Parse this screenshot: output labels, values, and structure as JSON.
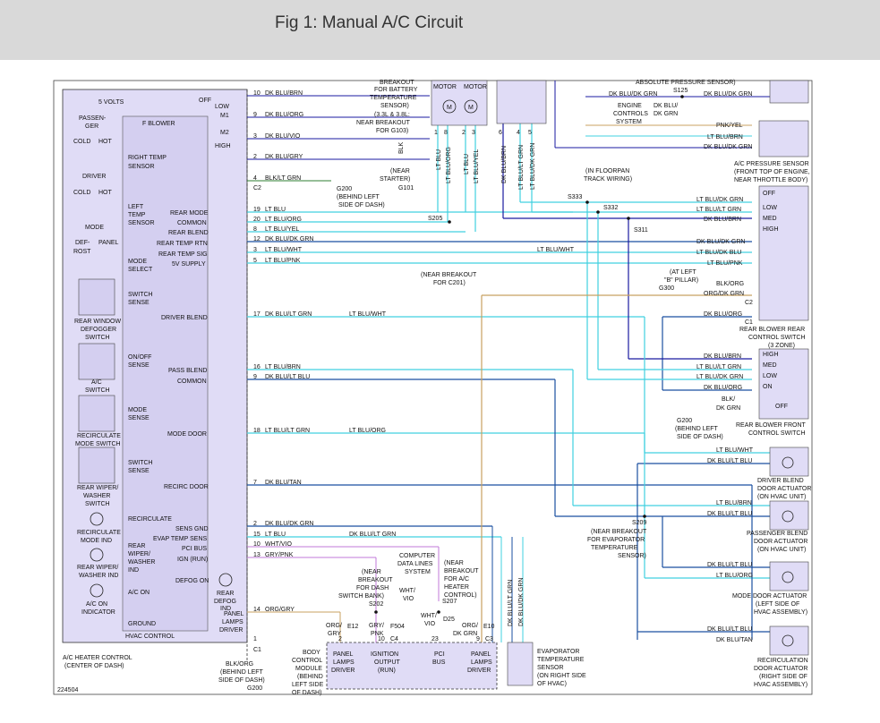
{
  "header": {
    "title": "Fig 1: Manual A/C Circuit"
  },
  "hvac": {
    "title": "HVAC CONTROL",
    "caption1": "A/C HEATER CONTROL",
    "caption2": "(CENTER OF DASH)",
    "five_volts": "5 VOLTS",
    "fig_number": "224504",
    "passenger": "PASSEN-",
    "passenger2": "GER",
    "driver": "DRIVER",
    "mode": "MODE",
    "cold": "COLD",
    "hot": "HOT",
    "cold2": "COLD",
    "hot2": "HOT",
    "defrost1": "DEF-",
    "defrost2": "ROST",
    "panel": "PANEL",
    "f_blower": "F BLOWER",
    "off": "OFF",
    "low": "LOW",
    "m1": "M1",
    "m2": "M2",
    "high": "HIGH",
    "right_temp1": "RIGHT TEMP",
    "right_temp2": "SENSOR",
    "left_temp1": "LEFT",
    "left_temp2": "TEMP",
    "left_temp3": "SENSOR",
    "mode_select1": "MODE",
    "mode_select2": "SELECT",
    "rear_mode": "REAR MODE",
    "common": "COMMON",
    "rear_blend": "REAR BLEND",
    "rear_temp_rtn": "REAR TEMP RTN",
    "rear_temp_sig": "REAR TEMP SIG",
    "supply_5v": "5V SUPPLY",
    "switch_sense1": "SWITCH",
    "switch_sense2": "SENSE",
    "rear_window1": "REAR WINDOW",
    "rear_window2": "DEFOGGER",
    "rear_window3": "SWITCH",
    "driver_blend": "DRIVER BLEND",
    "onoff_sense1": "ON/OFF",
    "onoff_sense2": "SENSE",
    "ac_switch1": "A/C",
    "ac_switch2": "SWITCH",
    "pass_blend": "PASS BLEND",
    "common2": "COMMON",
    "mode_sense1": "MODE",
    "mode_sense2": "SENSE",
    "recirc_mode1": "RECIRCULATE",
    "recirc_mode2": "MODE SWITCH",
    "mode_door": "MODE DOOR",
    "switch_sense3": "SWITCH",
    "switch_sense4": "SENSE",
    "rear_wiper1": "REAR WIPER/",
    "rear_wiper2": "WASHER",
    "rear_wiper3": "SWITCH",
    "recirc_door": "RECIRC DOOR",
    "recirculate": "RECIRCULATE",
    "recirc_ind1": "RECIRCULATE",
    "recirc_ind2": "MODE IND",
    "rear_wiper_ind1": "REAR",
    "rear_wiper_ind2": "WIPER/",
    "rear_wiper_ind3": "WASHER",
    "rear_wiper_ind4": "IND",
    "rw_ind1": "REAR WIPER/",
    "rw_ind2": "WASHER IND",
    "ac_on": "A/C ON",
    "ac_on_ind1": "A/C ON",
    "ac_on_ind2": "INDICATOR",
    "sens_gnd": "SENS GND",
    "evap_temp_sens": "EVAP TEMP SENS",
    "pci_bus": "PCI BUS",
    "ign_run": "IGN (RUN)",
    "defog_on": "DEFOG ON",
    "rear_defog1": "REAR",
    "rear_defog2": "DEFOG",
    "rear_defog3": "IND",
    "panel_lamps1": "PANEL",
    "panel_lamps2": "LAMPS",
    "panel_lamps3": "DRIVER",
    "ground": "GROUND"
  },
  "wires": [
    {
      "pin": "10",
      "color": "DK BLU/BRN"
    },
    {
      "pin": "9",
      "color": "DK BLU/ORG"
    },
    {
      "pin": "3",
      "color": "DK BLU/VIO"
    },
    {
      "pin": "2",
      "color": "DK BLU/GRY"
    },
    {
      "pin": "4",
      "color": "BLK/LT GRN"
    },
    {
      "pin": "19",
      "color": "LT BLU"
    },
    {
      "pin": "20",
      "color": "LT BLU/ORG"
    },
    {
      "pin": "8",
      "color": "LT BLU/YEL"
    },
    {
      "pin": "12",
      "color": "DK BLU/DK GRN"
    },
    {
      "pin": "3",
      "color": "LT BLU/WHT"
    },
    {
      "pin": "5",
      "color": "LT BLU/PNK"
    },
    {
      "pin": "17",
      "color": "DK BLU/LT GRN"
    },
    {
      "pin": "16",
      "color": "LT BLU/BRN"
    },
    {
      "pin": "9",
      "color": "DK BLU/LT BLU"
    },
    {
      "pin": "18",
      "color": "LT BLU/LT GRN"
    },
    {
      "pin": "7",
      "color": "DK BLU/TAN"
    },
    {
      "pin": "2",
      "color": "DK BLU/DK GRN"
    },
    {
      "pin": "15",
      "color": "LT BLU"
    },
    {
      "pin": "10",
      "color": "WHT/VIO"
    },
    {
      "pin": "13",
      "color": "GRY/PNK"
    },
    {
      "pin": "14",
      "color": "ORG/GRY"
    },
    {
      "pin": "1",
      "color": ""
    }
  ],
  "labels": {
    "c2": "C2",
    "c1": "C1",
    "g200_1": "G200",
    "g200_2": "(BEHIND LEFT",
    "g200_3": "SIDE OF DASH)",
    "lt_blu_wht_mid": "LT BLU/WHT",
    "lt_blu_wht_mid2": "LT BLU/WHT",
    "lt_blu_org_mid": "LT BLU/ORG",
    "dk_blu_lt_grn_mid": "DK BLU/LT GRN",
    "s205": "S205",
    "near_breakout1": "(NEAR BREAKOUT",
    "near_breakout2": "FOR C201)",
    "breakout_top1": "BREAKOUT",
    "breakout_top2": "FOR BATTERY",
    "breakout_top3": "TEMPERATURE",
    "breakout_top4": "SENSOR)",
    "breakout_top5": "(3.3L & 3.8L:",
    "breakout_top6": "NEAR BREAKOUT",
    "breakout_top7": "FOR G103)",
    "blk": "BLK",
    "near_starter1": "(NEAR",
    "near_starter2": "STARTER)",
    "g101": "G101",
    "motor1": "MOTOR",
    "motor2": "MOTOR",
    "top_wires": [
      "LT BLU",
      "LT BLU/ORG",
      "LT BLU",
      "LT BLU/YEL",
      "DK BLU/BRN",
      "LT BLU/LT GRN",
      "LT BLU/DK GRN"
    ],
    "top_pins": [
      "1",
      "8",
      "2",
      "3",
      "6",
      "4",
      "5"
    ],
    "abs_pressure": "ABSOLUTE PRESSURE SENSOR)",
    "s125": "S125",
    "dk_blu_dk_grn_top": "DK BLU/DK GRN",
    "dk_blu_dk_grn_top2": "DK BLU/DK GRN",
    "ecs1": "ENGINE",
    "ecs2": "CONTROLS",
    "ecs3": "SYSTEM",
    "dk_blu_dk_grn_v1": "DK BLU/",
    "dk_blu_dk_grn_v2": "DK GRN",
    "pnk_yel": "PNK/YEL",
    "lt_blu_brn_r": "LT BLU/BRN",
    "dk_blu_dk_grn_r": "DK BLU/DK GRN",
    "ac_pressure1": "A/C PRESSURE SENSOR",
    "ac_pressure2": "(FRONT TOP OF ENGINE,",
    "ac_pressure3": "NEAR THROTTLE BODY)",
    "floorpan1": "(IN FLOORPAN",
    "floorpan2": "TRACK WIRING)",
    "s333": "S333",
    "s332": "S332",
    "s311": "S311",
    "rb_wire1": "LT BLU/DK GRN",
    "rb_wire2": "LT BLU/LT GRN",
    "rb_wire3": "DK BLU/BRN",
    "rb_wire4": "DK BLU/DK GRN",
    "rb_wire5": "LT BLU/DK BLU",
    "rb_wire6": "LT BLU/PNK",
    "rb_off": "OFF",
    "rb_low": "LOW",
    "rb_med": "MED",
    "rb_high": "HIGH",
    "at_left1": "(AT LEFT",
    "at_left2": "\"B\" PILLAR)",
    "g300": "G300",
    "blk_org": "BLK/ORG",
    "org_dk_grn": "ORG/DK GRN",
    "c2r": "C2",
    "dk_blu_org_r": "DK BLU/ORG",
    "c1r": "C1",
    "rear_ctrl1": "REAR BLOWER REAR",
    "rear_ctrl2": "CONTROL SWITCH",
    "rear_ctrl3": "(3 ZONE)",
    "fb_wire1": "DK BLU/BRN",
    "fb_wire2": "LT BLU/LT GRN",
    "fb_wire3": "LT BLU/DK GRN",
    "fb_wire4": "DK BLU/ORG",
    "fb_high": "HIGH",
    "fb_med": "MED",
    "fb_low": "LOW",
    "fb_on": "ON",
    "fb_off": "OFF",
    "blk_dkgrn1": "BLK/",
    "blk_dkgrn2": "DK GRN",
    "g200r1": "G200",
    "g200r2": "(BEHIND LEFT",
    "g200r3": "SIDE OF DASH)",
    "front_ctrl1": "REAR BLOWER FRONT",
    "front_ctrl2": "CONTROL SWITCH",
    "lt_blu_org_mid2": "LT BLU/ORG",
    "lt_blu_wht_r": "LT BLU/WHT",
    "dk_blu_lt_blu_r": "DK BLU/LT BLU",
    "driver_blend1": "DRIVER BLEND",
    "driver_blend2": "DOOR ACTUATOR",
    "driver_blend3": "(ON HVAC UNIT)",
    "lt_blu_brn_p": "LT BLU/BRN",
    "dk_blu_lt_blu_p": "DK BLU/LT BLU",
    "s209": "S209",
    "near_evap1": "(NEAR BREAKOUT",
    "near_evap2": "FOR EVAPORATOR",
    "near_evap3": "TEMPERATURE",
    "near_evap4": "SENSOR)",
    "pass_blend1": "PASSENGER BLEND",
    "pass_blend2": "DOOR ACTUATOR",
    "pass_blend3": "(ON HVAC UNIT)",
    "dk_blu_lt_blu_m": "DK BLU/LT BLU",
    "lt_blu_org_m": "LT BLU/ORG",
    "mode_door1": "MODE DOOR ACTUATOR",
    "mode_door2": "(LEFT SIDE OF",
    "mode_door3": "HVAC ASSEMBLY)",
    "dk_blu_lt_blu_rc": "DK BLU/LT BLU",
    "dk_blu_tan_rc": "DK BLU/TAN",
    "recirc_act1": "RECIRCULATION",
    "recirc_act2": "DOOR ACTUATOR",
    "recirc_act3": "(RIGHT SIDE OF",
    "recirc_act4": "HVAC ASSEMBLY)",
    "evap1": "EVAPORATOR",
    "evap2": "TEMPERATURE",
    "evap3": "SENSOR",
    "evap4": "(ON RIGHT SIDE",
    "evap5": "OF HVAC)",
    "dk_blu_lt_grn_v": "DK BLU/LT GRN",
    "dk_blu_dk_grn_v": "DK BLU/DK GRN",
    "dk_blu_lt_grn_bus": "DK BLU/LT GRN",
    "cdl1": "COMPUTER",
    "cdl2": "DATA LINES",
    "cdl3": "SYSTEM",
    "near_dash1": "(NEAR",
    "near_dash2": "BREAKOUT",
    "near_dash3": "FOR DASH",
    "near_dash4": "SWITCH BANK)",
    "s202": "S202",
    "near_ac1": "(NEAR",
    "near_ac2": "BREAKOUT",
    "near_ac3": "FOR A/C",
    "near_ac4": "HEATER",
    "near_ac5": "CONTROL)",
    "s207": "S207",
    "wht_vio1": "WHT/",
    "wht_vio2": "VIO",
    "wht_vio3": "WHT/",
    "wht_vio4": "VIO",
    "d25": "D25",
    "org_gry1": "ORG/",
    "org_gry2": "GRY",
    "e12": "E12",
    "gry_pnk1": "GRY/",
    "gry_pnk2": "PNK",
    "f504": "F504",
    "org_dkgrn1": "ORG/",
    "org_dkgrn2": "DK GRN",
    "e10": "E10",
    "pin2": "2",
    "pin10": "10",
    "c4": "C4",
    "pin23": "23",
    "pin9": "9",
    "c3": "C3",
    "bcm1": "BODY",
    "bcm2": "CONTROL",
    "bcm3": "MODULE",
    "bcm4": "(BEHIND",
    "bcm5": "LEFT SIDE",
    "bcm6": "OF DASH)",
    "bcm_panel1": "PANEL",
    "bcm_panel2": "LAMPS",
    "bcm_panel3": "DRIVER",
    "bcm_ign1": "IGNITION",
    "bcm_ign2": "OUTPUT",
    "bcm_ign3": "(RUN)",
    "bcm_pci1": "PCI",
    "bcm_pci2": "BUS",
    "bcm_panel4": "PANEL",
    "bcm_panel5": "LAMPS",
    "bcm_panel6": "DRIVER",
    "blk_org_b": "BLK/ORG",
    "g200b1": "(BEHIND LEFT",
    "g200b2": "SIDE OF DASH)",
    "g200b3": "G200",
    "c1b": "C1"
  }
}
